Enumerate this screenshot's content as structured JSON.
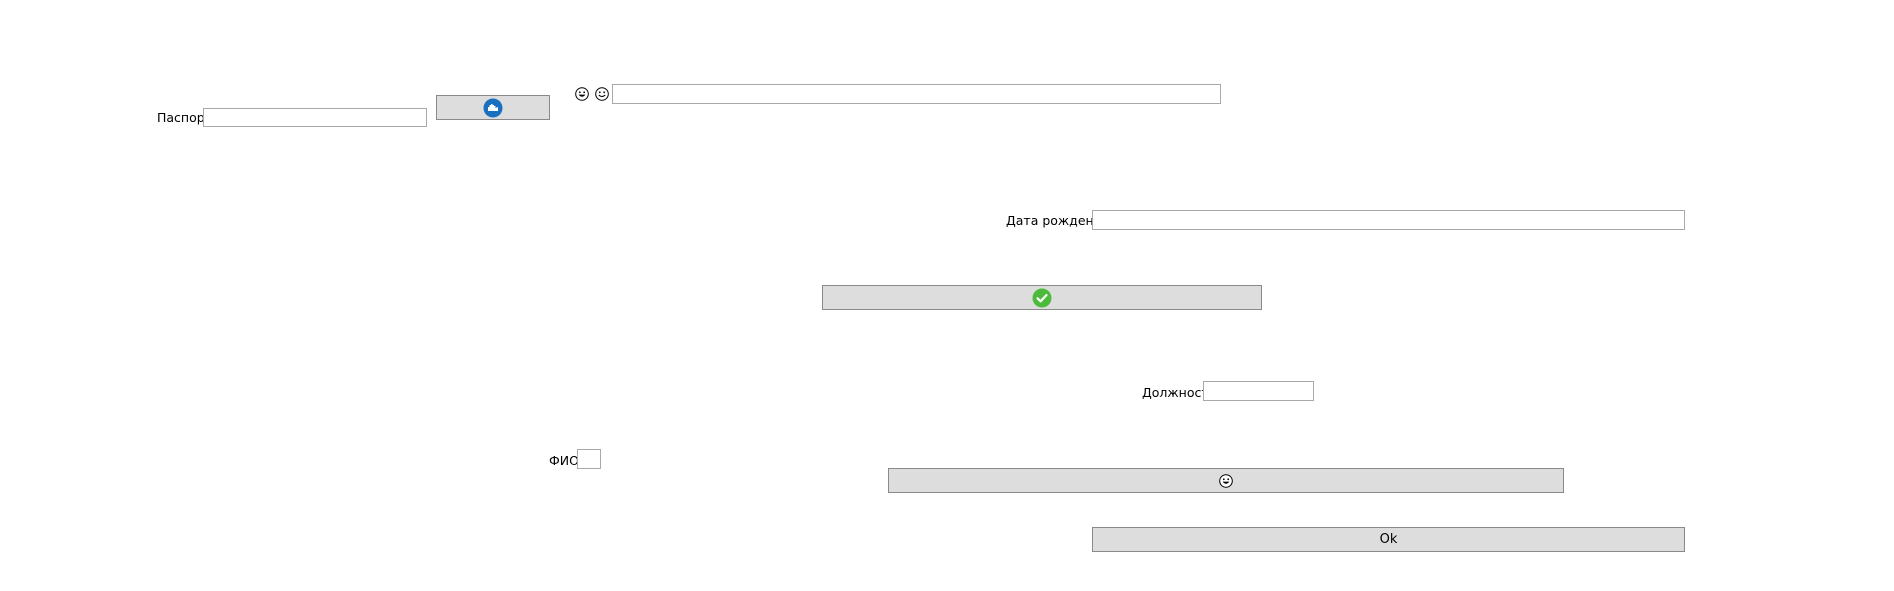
{
  "passport": {
    "label": "Паспорт",
    "value": "",
    "placeholder": ""
  },
  "top_search": {
    "value": "",
    "placeholder": ""
  },
  "birth_date": {
    "label": "Дата рождения",
    "value": "",
    "placeholder": ""
  },
  "position": {
    "label": "Должность",
    "value": "",
    "placeholder": ""
  },
  "full_name": {
    "label": "ФИО",
    "value": "",
    "placeholder": ""
  },
  "buttons": {
    "passport_icon": "hand-badge-icon",
    "confirm_icon": "check-circle-icon",
    "emoji_icon": "grinning-face-icon",
    "ok_label": "Ok"
  },
  "icons": {
    "top_emoji_1": "grinning-face-icon",
    "top_emoji_2": "smiling-face-icon"
  },
  "colors": {
    "button_bg": "#dddddd",
    "blue_icon": "#1a6fc0",
    "green_icon": "#4cbb3c"
  }
}
